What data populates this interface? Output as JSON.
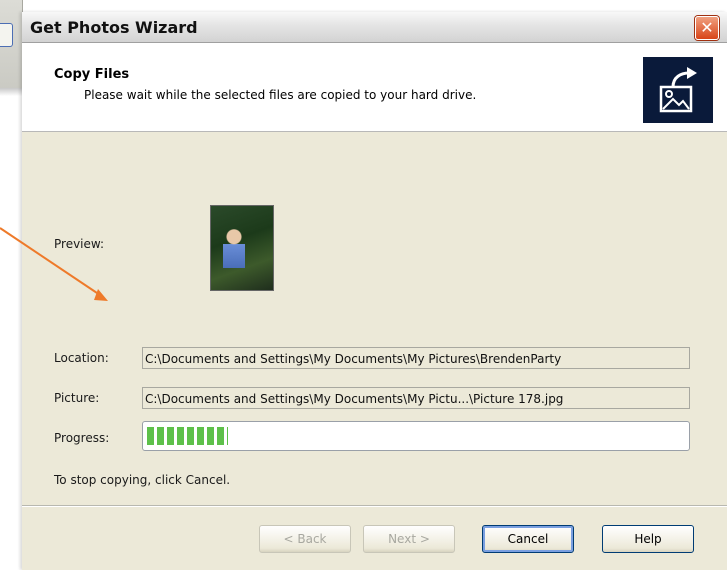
{
  "dialog": {
    "title": "Get Photos Wizard",
    "close_glyph": "✕"
  },
  "header": {
    "title": "Copy Files",
    "subtitle": "Please wait while the selected files are copied to your hard drive."
  },
  "fields": {
    "preview_label": "Preview:",
    "location_label": "Location:",
    "location_value": "C:\\Documents and Settings\\My Documents\\My Pictures\\BrendenParty",
    "picture_label": "Picture:",
    "picture_value": "C:\\Documents and Settings\\My Documents\\My Pictu...\\Picture 178.jpg",
    "progress_label": "Progress:",
    "progress_fraction": 0.15
  },
  "hint": "To stop copying, click Cancel.",
  "buttons": {
    "back": "< Back",
    "next": "Next >",
    "cancel": "Cancel",
    "help": "Help"
  },
  "colors": {
    "annotation_arrow": "#ee7a2a",
    "progress_fill": "#5ec04a"
  }
}
